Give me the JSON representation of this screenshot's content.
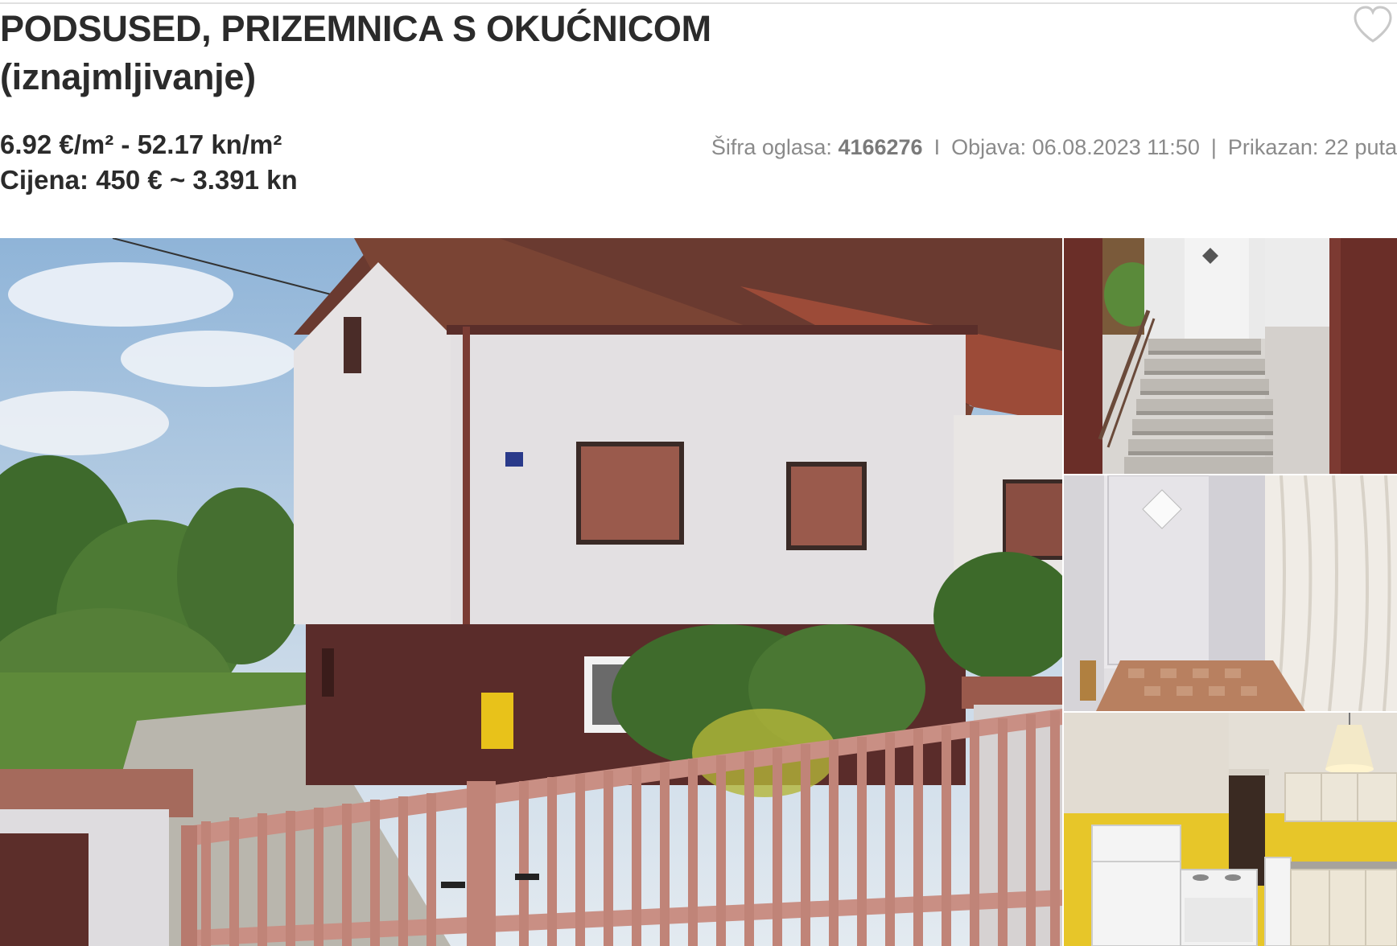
{
  "listing": {
    "title_line1": "PODSUSED, PRIZEMNICA S OKUĆNICOM",
    "title_line2": "(iznajmljivanje)",
    "price_per_m2": "6.92 €/m² - 52.17 kn/m²",
    "price_total": "Cijena: 450 € ~ 3.391 kn"
  },
  "meta": {
    "code_label": "Šifra oglasa:",
    "code_value": "4166276",
    "sep1": "I",
    "published": "Objava: 06.08.2023 11:50",
    "sep2": "|",
    "views": "Prikazan: 22 puta"
  },
  "icons": {
    "favorite": "heart-outline-icon"
  },
  "colors": {
    "title": "#2b2b2b",
    "meta": "#8a8a8a",
    "heart_stroke": "#c8c8c8"
  }
}
